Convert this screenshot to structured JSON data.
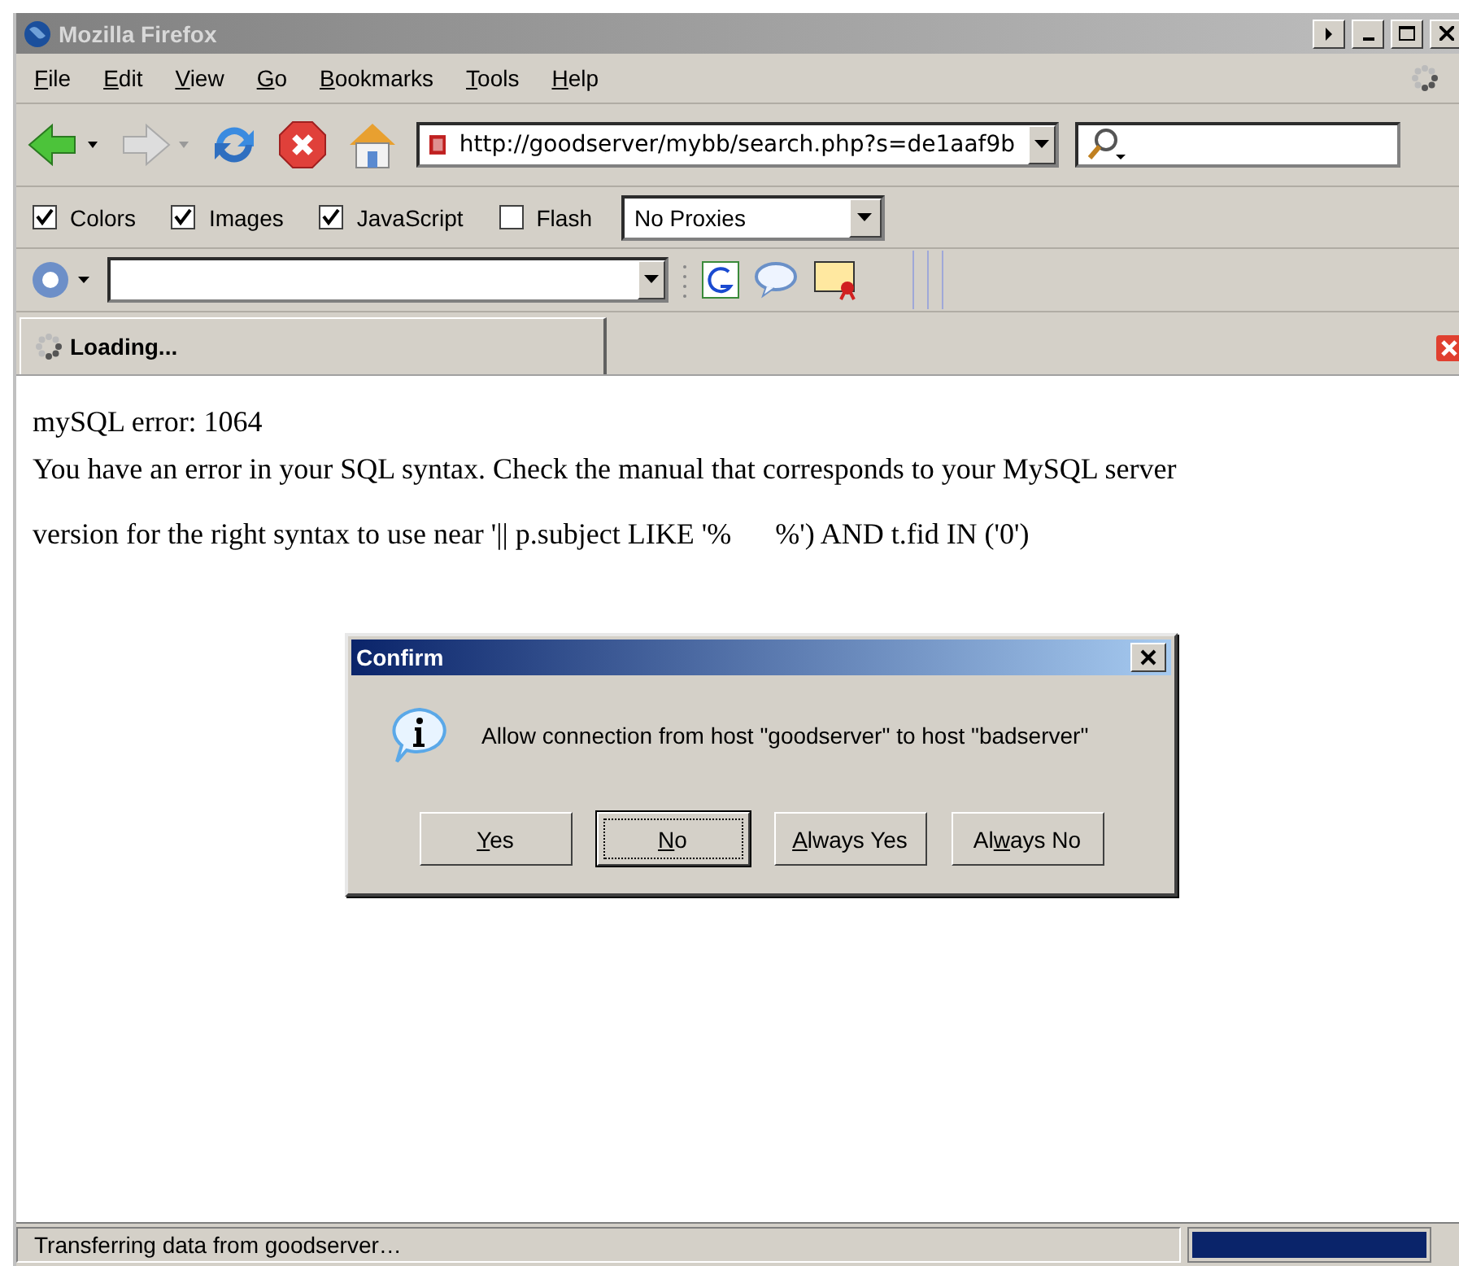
{
  "window": {
    "title": "Mozilla Firefox"
  },
  "menu": [
    {
      "key": "F",
      "post": "ile"
    },
    {
      "key": "E",
      "post": "dit"
    },
    {
      "key": "V",
      "post": "iew"
    },
    {
      "key": "G",
      "post": "o"
    },
    {
      "key": "B",
      "post": "ookmarks"
    },
    {
      "key": "T",
      "post": "ools"
    },
    {
      "key": "H",
      "post": "elp"
    }
  ],
  "navigation": {
    "url": "http://goodserver/mybb/search.php?s=de1aaf9b"
  },
  "developer_toolbar": {
    "options": [
      {
        "label": "Colors",
        "checked": true
      },
      {
        "label": "Images",
        "checked": true
      },
      {
        "label": "JavaScript",
        "checked": true
      },
      {
        "label": "Flash",
        "checked": false
      }
    ],
    "proxy": "No Proxies"
  },
  "tabs": [
    {
      "label": "Loading...",
      "selected": true
    }
  ],
  "content": {
    "lines": [
      "mySQL error: 1064",
      "You have an error in your SQL syntax. Check the manual that corresponds to your MySQL server",
      "version for the right syntax to use near '|| p.subject LIKE '%      %') AND t.fid IN ('0')"
    ]
  },
  "dialog": {
    "title": "Confirm",
    "message": "Allow connection from host \"goodserver\" to host \"badserver\"",
    "buttons": [
      {
        "key": "Y",
        "post": "es",
        "focused": false
      },
      {
        "key": "N",
        "post": "o",
        "focused": true
      },
      {
        "key": "A",
        "post": "lways Yes",
        "focused": false
      },
      {
        "pre": "Al",
        "key": "w",
        "post": "ays No",
        "focused": false
      }
    ]
  },
  "status_bar": {
    "text": "Transferring data from goodserver…",
    "level": 1
  }
}
